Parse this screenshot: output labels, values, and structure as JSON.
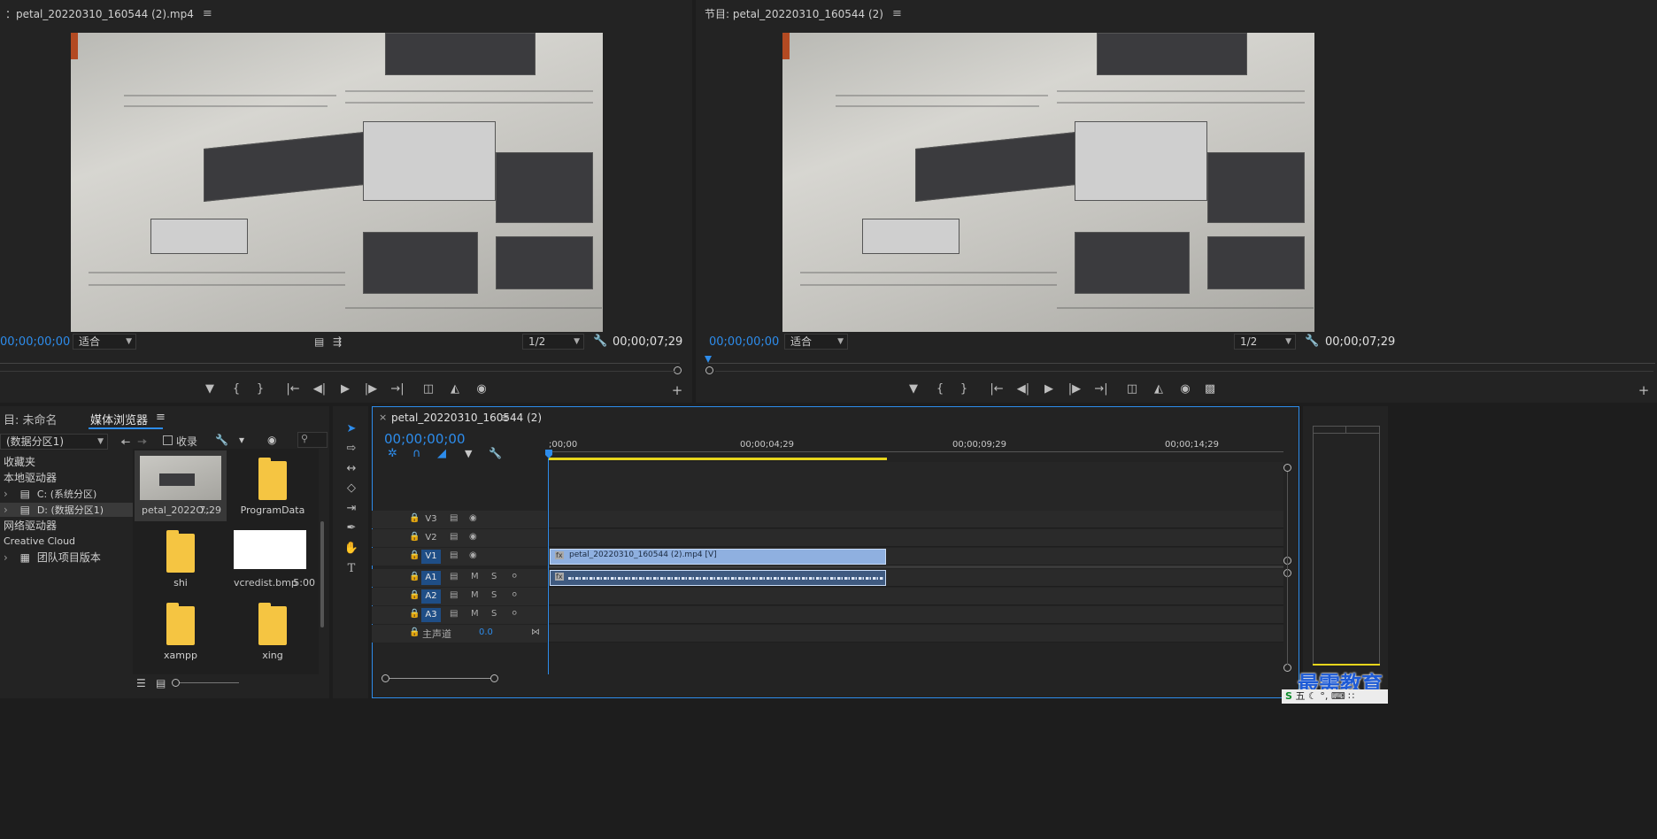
{
  "source_monitor": {
    "title": "：petal_20220310_160544 (2).mp4",
    "menu": "≡",
    "timecode_left": "00;00;00;00",
    "fit_label": "适合",
    "resolution": "1/2",
    "timecode_right": "00;00;07;29"
  },
  "program_monitor": {
    "title": "节目: petal_20220310_160544 (2)",
    "menu": "≡",
    "timecode_left": "00;00;00;00",
    "fit_label": "适合",
    "resolution": "1/2",
    "timecode_right": "00;00;07;29"
  },
  "project_panel": {
    "tab_project": "目: 未命名",
    "tab_media": "媒体浏览器",
    "drive_select": "(数据分区1)",
    "favorites_checkbox": "收录",
    "tree": [
      {
        "label": "收藏夹"
      },
      {
        "label": "本地驱动器"
      },
      {
        "label": "C: (系统分区)"
      },
      {
        "label": "D: (数据分区1)"
      },
      {
        "label": "网络驱动器"
      },
      {
        "label": "Creative Cloud"
      },
      {
        "label": "团队项目版本"
      }
    ],
    "items": [
      {
        "name": "petal_2022O...",
        "duration": "7;29"
      },
      {
        "name": "ProgramData",
        "duration": ""
      },
      {
        "name": "shi",
        "duration": ""
      },
      {
        "name": "vcredist.bmp",
        "duration": "5:00"
      },
      {
        "name": "xampp",
        "duration": ""
      },
      {
        "name": "xing",
        "duration": ""
      }
    ]
  },
  "timeline": {
    "tab_title": "petal_20220310_160544 (2)",
    "close": "×",
    "menu": "≡",
    "timecode": "00;00;00;00",
    "ruler_labels": [
      ";00;00",
      "00;00;04;29",
      "00;00;09;29",
      "00;00;14;29"
    ],
    "tracks": {
      "video": [
        "V3",
        "V2",
        "V1"
      ],
      "audio": [
        "A1",
        "A2",
        "A3"
      ],
      "master": "主声道",
      "master_value": "0.0"
    },
    "video_clip": "petal_20220310_160544 (2).mp4 [V]",
    "m_label": "M",
    "s_label": "S"
  },
  "watermark": {
    "text": "最需教育",
    "ime": "五"
  },
  "colors": {
    "accent": "#2d8ceb",
    "clip_video": "#8fb0e0",
    "clip_audio": "#3f5a80",
    "track_selected": "#1f4e86",
    "work_area": "#e6d51c"
  }
}
